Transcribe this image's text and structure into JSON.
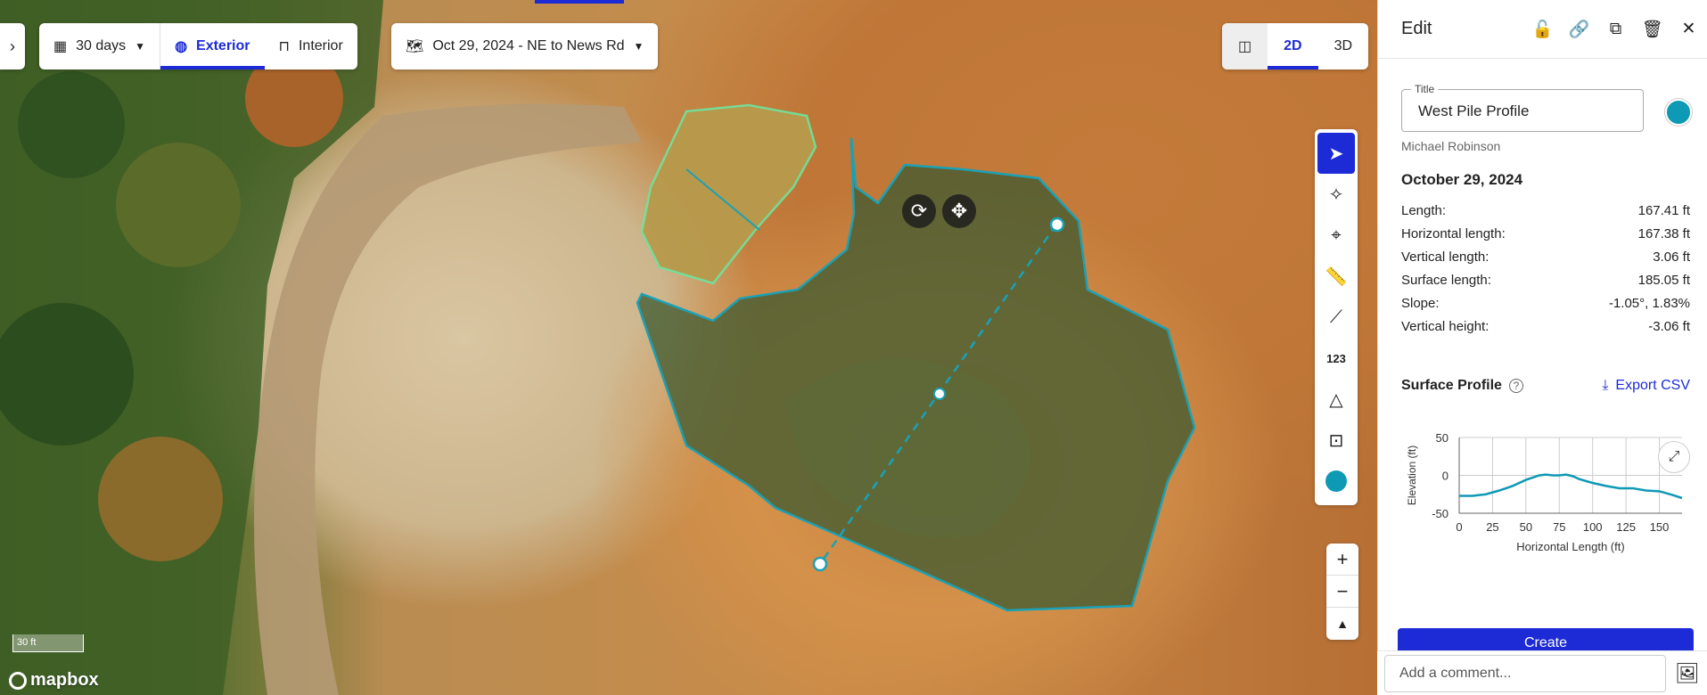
{
  "toolbar": {
    "expand_icon": "chevron-right-icon",
    "range_label": "30 days",
    "exterior_label": "Exterior",
    "interior_label": "Interior",
    "date_label": "Oct 29, 2024 - NE to News Rd"
  },
  "view": {
    "mode_2d": "2D",
    "mode_3d": "3D",
    "active": "2D"
  },
  "tools": [
    "select-icon",
    "magic-icon",
    "location-pin-icon",
    "ruler-icon",
    "polyline-icon",
    "123",
    "volume-icon",
    "area-icon",
    "color-icon"
  ],
  "tools_number_label": "123",
  "zoom": {
    "in": "+",
    "out": "−",
    "north": "▲"
  },
  "map": {
    "scale_label": "30 ft",
    "attribution": "mapbox"
  },
  "side": {
    "title": "Edit",
    "field_label": "Title",
    "field_value": "West Pile Profile",
    "color": "#0e99b4",
    "author": "Michael Robinson",
    "date": "October 29, 2024",
    "stats": [
      {
        "label": "Length:",
        "value": "167.41 ft"
      },
      {
        "label": "Horizontal length:",
        "value": "167.38 ft"
      },
      {
        "label": "Vertical length:",
        "value": "3.06 ft"
      },
      {
        "label": "Surface length:",
        "value": "185.05 ft"
      },
      {
        "label": "Slope:",
        "value": "-1.05°, 1.83%"
      },
      {
        "label": "Vertical height:",
        "value": "-3.06 ft"
      }
    ],
    "profile_title": "Surface Profile",
    "export_label": "Export CSV",
    "primary_button": "Create",
    "comment_placeholder": "Add a comment..."
  },
  "chart_data": {
    "type": "line",
    "xlabel": "Horizontal Length (ft)",
    "ylabel": "Elevation (ft)",
    "xlim": [
      0,
      167
    ],
    "ylim": [
      -50,
      50
    ],
    "xticks": [
      0,
      25,
      50,
      75,
      100,
      125,
      150
    ],
    "yticks": [
      50,
      0,
      -50
    ],
    "x": [
      0,
      10,
      20,
      30,
      40,
      50,
      55,
      60,
      65,
      70,
      75,
      80,
      85,
      90,
      100,
      110,
      120,
      130,
      140,
      150,
      160,
      167
    ],
    "y": [
      -27,
      -27,
      -25,
      -20,
      -14,
      -6,
      -3,
      0,
      1,
      0,
      0,
      1,
      -1,
      -5,
      -10,
      -14,
      -17,
      -17,
      -20,
      -21,
      -26,
      -30
    ],
    "grid": true
  }
}
